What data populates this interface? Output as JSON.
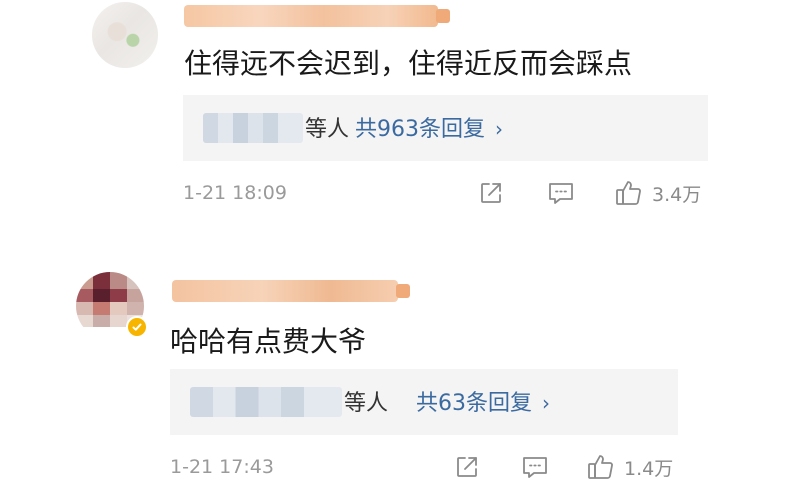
{
  "comments": [
    {
      "text": "住得远不会迟到，住得近反而会踩点",
      "reply_summary": {
        "who_suffix": "等人",
        "link": "共963条回复"
      },
      "time": "1-21 18:09",
      "likes": "3.4万"
    },
    {
      "text": "哈哈有点费大爷",
      "reply_summary": {
        "who_suffix": "等人",
        "link": "共63条回复"
      },
      "time": "1-21 17:43",
      "likes": "1.4万"
    }
  ],
  "icons": {
    "share": "share-icon",
    "comment": "comment-icon",
    "like": "thumbs-up-icon",
    "chevron": "chevron-right-icon",
    "verified": "verified-badge-icon"
  },
  "colors": {
    "link": "#3b6aa0",
    "meta": "#9a9a9a",
    "reply_bg": "#f4f4f4",
    "verified": "#f7b500"
  }
}
